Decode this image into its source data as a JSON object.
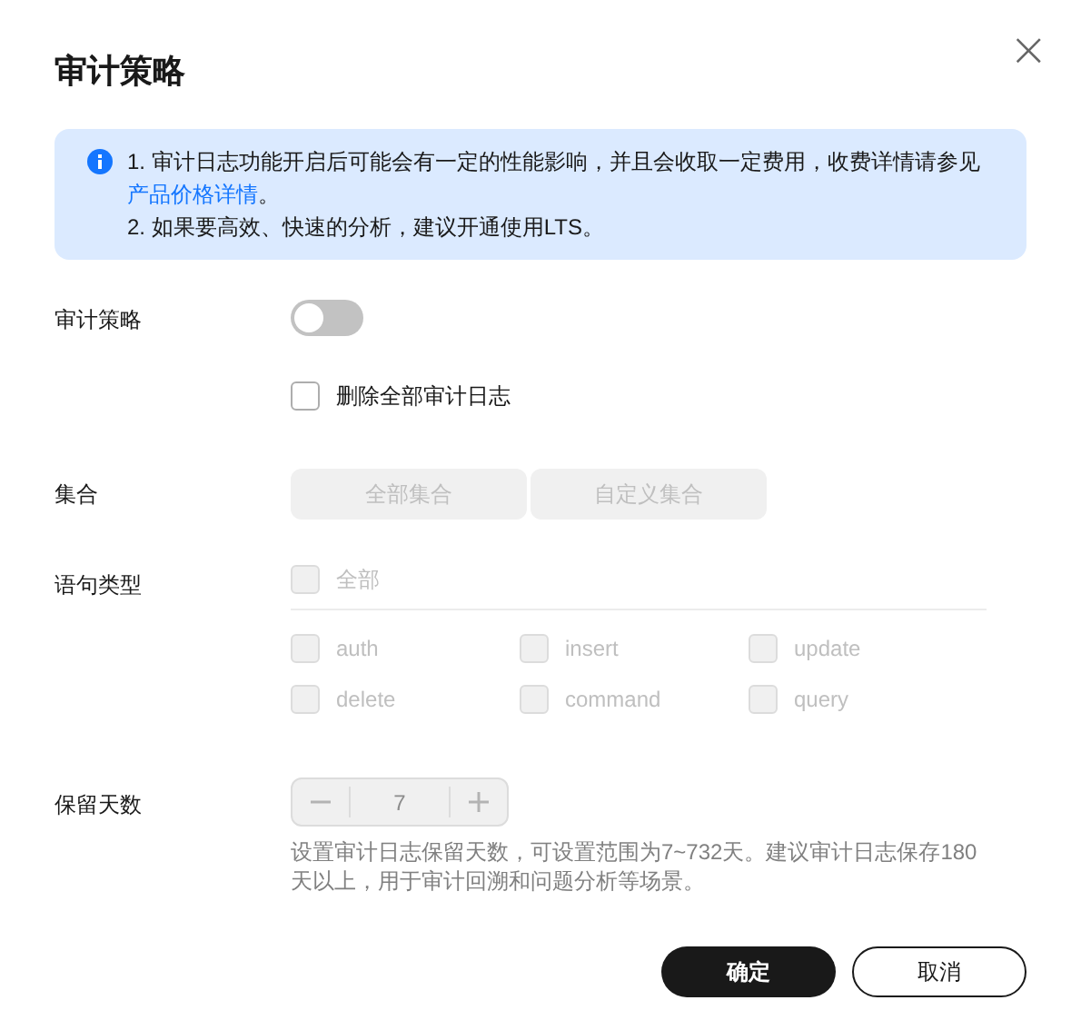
{
  "dialog": {
    "title": "审计策略",
    "close": "×"
  },
  "notice": {
    "lines": [
      {
        "text": "1. 审计日志功能开启后可能会有一定的性能影响，并且会收取一定费用，收费详情请参见",
        "link": "产品价格详情",
        "suffix": "。"
      },
      {
        "text": "2. 如果要高效、快速的分析，建议开通使用LTS。"
      }
    ]
  },
  "audit_policy": {
    "label": "审计策略",
    "on": false
  },
  "delete_logs": {
    "label": "删除全部审计日志",
    "checked": false
  },
  "collection": {
    "label": "集合",
    "options": [
      {
        "label": "全部集合",
        "selected": false,
        "disabled": true
      },
      {
        "label": "自定义集合",
        "selected": false,
        "disabled": true
      }
    ]
  },
  "statement_types": {
    "label": "语句类型",
    "all": {
      "label": "全部",
      "checked": false,
      "disabled": true
    },
    "options": [
      {
        "label": "auth",
        "checked": false,
        "disabled": true
      },
      {
        "label": "insert",
        "checked": false,
        "disabled": true
      },
      {
        "label": "update",
        "checked": false,
        "disabled": true
      },
      {
        "label": "delete",
        "checked": false,
        "disabled": true
      },
      {
        "label": "command",
        "checked": false,
        "disabled": true
      },
      {
        "label": "query",
        "checked": false,
        "disabled": true
      }
    ]
  },
  "retention": {
    "label": "保留天数",
    "value": "7",
    "disabled": true,
    "help": "设置审计日志保留天数，可设置范围为7~732天。建议审计日志保存180天以上，用于审计回溯和问题分析等场景。"
  },
  "buttons": [
    {
      "label": "确定",
      "kind": "primary"
    },
    {
      "label": "取消",
      "kind": "secondary"
    }
  ]
}
